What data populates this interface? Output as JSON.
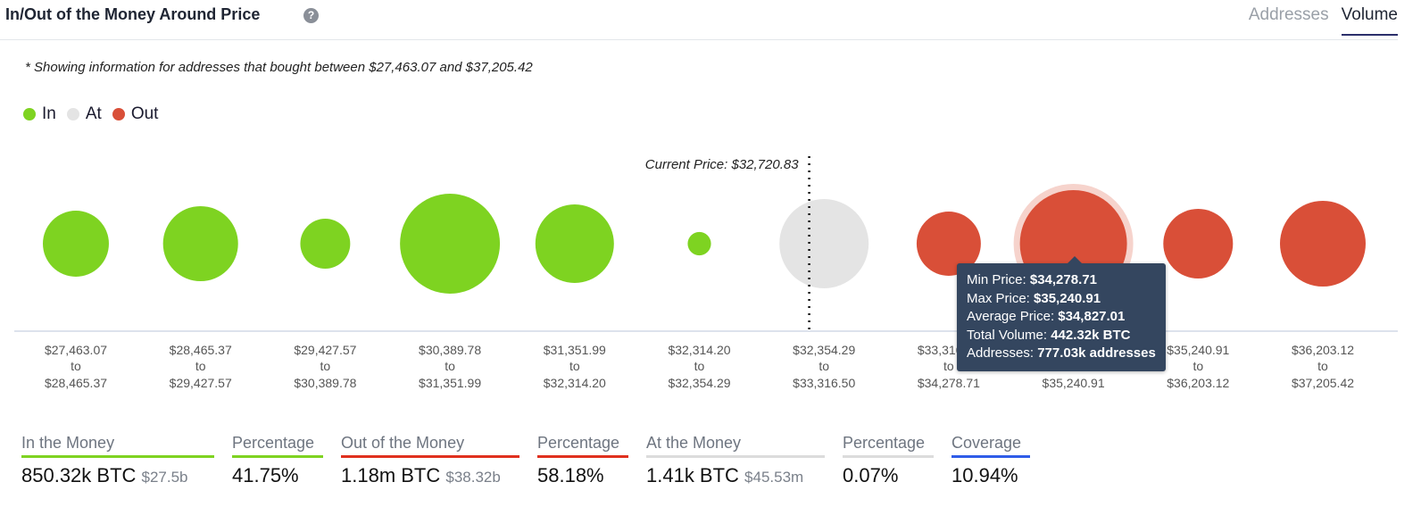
{
  "header": {
    "title": "In/Out of the Money Around Price",
    "help_icon": "question-circle-icon",
    "tabs": [
      {
        "label": "Addresses",
        "active": false
      },
      {
        "label": "Volume",
        "active": true
      }
    ]
  },
  "note": "* Showing information for addresses that bought between $27,463.07 and $37,205.42",
  "legend": [
    {
      "label": "In",
      "color": "#7ed321"
    },
    {
      "label": "At",
      "color": "#e4e4e4"
    },
    {
      "label": "Out",
      "color": "#d94f38"
    }
  ],
  "chart_data": {
    "type": "bubble",
    "current_price_label": "Current Price: $32,720.83",
    "current_price": 32720.83,
    "unit": "k BTC (estimated from bubble size)",
    "bins": [
      {
        "from": "$27,463.07",
        "to": "$28,465.37",
        "status": "In",
        "volume": 168
      },
      {
        "from": "$28,465.37",
        "to": "$29,427.57",
        "status": "In",
        "volume": 217
      },
      {
        "from": "$29,427.57",
        "to": "$30,389.78",
        "status": "In",
        "volume": 96
      },
      {
        "from": "$30,389.78",
        "to": "$31,351.99",
        "status": "In",
        "volume": 385
      },
      {
        "from": "$31,351.99",
        "to": "$32,314.20",
        "status": "In",
        "volume": 238
      },
      {
        "from": "$32,314.20",
        "to": "$32,354.29",
        "status": "In",
        "volume": 21
      },
      {
        "from": "$32,354.29",
        "to": "$33,316.50",
        "status": "At",
        "volume": 307
      },
      {
        "from": "$33,316.50",
        "to": "$34,278.71",
        "status": "Out",
        "volume": 159
      },
      {
        "from": "$34,278.71",
        "to": "$35,240.91",
        "status": "Out",
        "volume": 442.32,
        "hovered": true
      },
      {
        "from": "$35,240.91",
        "to": "$36,203.12",
        "status": "Out",
        "volume": 187
      },
      {
        "from": "$36,203.12",
        "to": "$37,205.42",
        "status": "Out",
        "volume": 283
      }
    ],
    "to_word": "to"
  },
  "tooltip": [
    {
      "label": "Min Price: ",
      "value": "$34,278.71"
    },
    {
      "label": "Max Price: ",
      "value": "$35,240.91"
    },
    {
      "label": "Average Price: ",
      "value": "$34,827.01"
    },
    {
      "label": "Total Volume: ",
      "value": "442.32k BTC"
    },
    {
      "label": "Addresses: ",
      "value": "777.03k addresses"
    }
  ],
  "stats": [
    {
      "label": "In the Money",
      "value": "850.32k BTC",
      "sub": "$27.5b",
      "color": "#7ed321"
    },
    {
      "label": "Percentage",
      "value": "41.75%",
      "sub": "",
      "color": "#7ed321"
    },
    {
      "label": "Out of the Money",
      "value": "1.18m BTC",
      "sub": "$38.32b",
      "color": "#e0301e"
    },
    {
      "label": "Percentage",
      "value": "58.18%",
      "sub": "",
      "color": "#e0301e"
    },
    {
      "label": "At the Money",
      "value": "1.41k BTC",
      "sub": "$45.53m",
      "color": "#dcdcdc"
    },
    {
      "label": "Percentage",
      "value": "0.07%",
      "sub": "",
      "color": "#dcdcdc"
    },
    {
      "label": "Coverage",
      "value": "10.94%",
      "sub": "",
      "color": "#2f5ce8"
    }
  ]
}
